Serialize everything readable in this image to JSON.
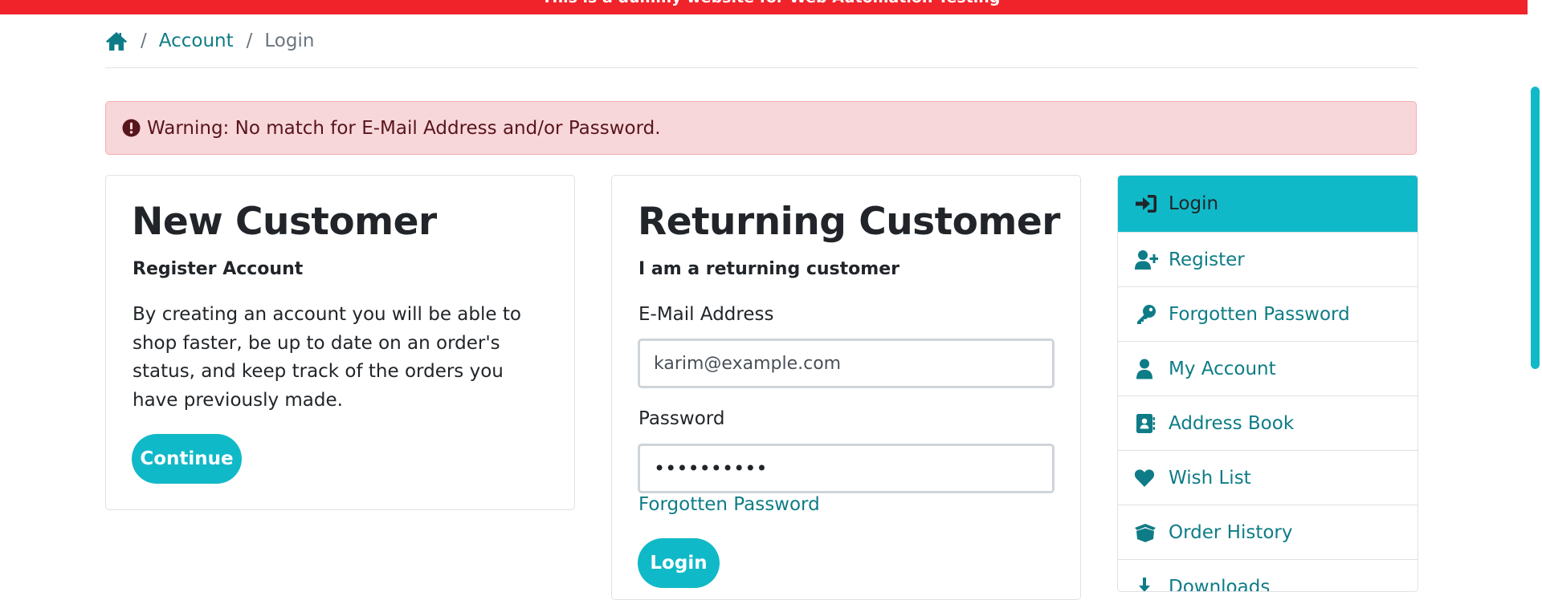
{
  "topbar": {
    "text": "This is a dummy website for Web Automation Testing"
  },
  "breadcrumb": {
    "items": [
      "Account",
      "Login"
    ],
    "separator": "/"
  },
  "alert": {
    "text": "Warning: No match for E-Mail Address and/or Password."
  },
  "new_customer": {
    "title": "New Customer",
    "subtitle": "Register Account",
    "body": "By creating an account you will be able to shop faster, be up to date on an order's status, and keep track of the orders you have previously made.",
    "button": "Continue"
  },
  "returning_customer": {
    "title": "Returning Customer",
    "subtitle": "I am a returning customer",
    "email_label": "E-Mail Address",
    "email_value": "karim@example.com",
    "password_label": "Password",
    "password_value": "••••••••••",
    "forgot_link": "Forgotten Password",
    "button": "Login"
  },
  "sidebar": {
    "items": [
      {
        "label": "Login",
        "icon": "sign-in-icon",
        "active": true
      },
      {
        "label": "Register",
        "icon": "user-plus-icon"
      },
      {
        "label": "Forgotten Password",
        "icon": "key-icon"
      },
      {
        "label": "My Account",
        "icon": "user-icon"
      },
      {
        "label": "Address Book",
        "icon": "address-book-icon"
      },
      {
        "label": "Wish List",
        "icon": "heart-icon"
      },
      {
        "label": "Order History",
        "icon": "box-open-icon"
      },
      {
        "label": "Downloads",
        "icon": "download-icon"
      }
    ]
  },
  "colors": {
    "accent": "#10b9c8",
    "link": "#0e7c86",
    "topbar": "#f0232b",
    "alert_bg": "#f8d7da"
  }
}
